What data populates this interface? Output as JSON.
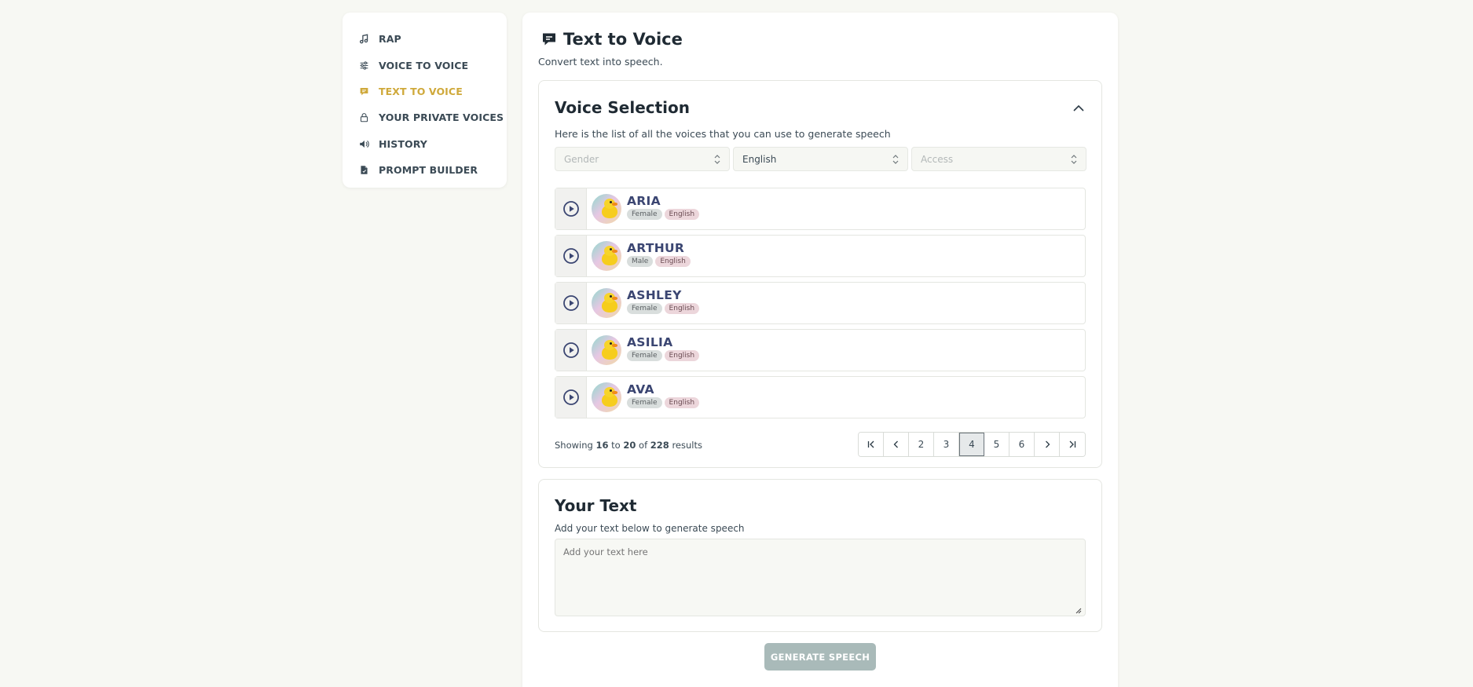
{
  "sidebar": {
    "items": [
      {
        "label": "RAP",
        "icon": "music-note-icon"
      },
      {
        "label": "VOICE TO VOICE",
        "icon": "sliders-icon"
      },
      {
        "label": "TEXT TO VOICE",
        "icon": "chat-bubble-icon",
        "active": true
      },
      {
        "label": "YOUR PRIVATE VOICES",
        "icon": "lock-icon"
      },
      {
        "label": "HISTORY",
        "icon": "speaker-icon"
      },
      {
        "label": "PROMPT BUILDER",
        "icon": "document-icon"
      }
    ]
  },
  "colors": {
    "accent": "#cfa93b",
    "button_disabled": "#a9bab9",
    "voice_name": "#3b4672"
  },
  "main": {
    "title": "Text to Voice",
    "subtitle": "Convert text into speech.",
    "voice_selection": {
      "title": "Voice Selection",
      "description": "Here is the list of all the voices that you can use to generate speech",
      "filters": {
        "gender_placeholder": "Gender",
        "language_value": "English",
        "access_placeholder": "Access"
      },
      "voices": [
        {
          "name": "ARIA",
          "gender": "Female",
          "language": "English"
        },
        {
          "name": "ARTHUR",
          "gender": "Male",
          "language": "English"
        },
        {
          "name": "ASHLEY",
          "gender": "Female",
          "language": "English"
        },
        {
          "name": "ASILIA",
          "gender": "Female",
          "language": "English"
        },
        {
          "name": "AVA",
          "gender": "Female",
          "language": "English"
        }
      ],
      "results": {
        "prefix": "Showing",
        "from": "16",
        "to_word": "to",
        "to": "20",
        "of_word": "of",
        "total": "228",
        "suffix": "results"
      },
      "pagination": {
        "pages": [
          "2",
          "3",
          "4",
          "5",
          "6"
        ],
        "current": "4"
      }
    },
    "your_text": {
      "title": "Your Text",
      "description": "Add your text below to generate speech",
      "placeholder": "Add your text here"
    },
    "generate_button": "GENERATE SPEECH"
  }
}
